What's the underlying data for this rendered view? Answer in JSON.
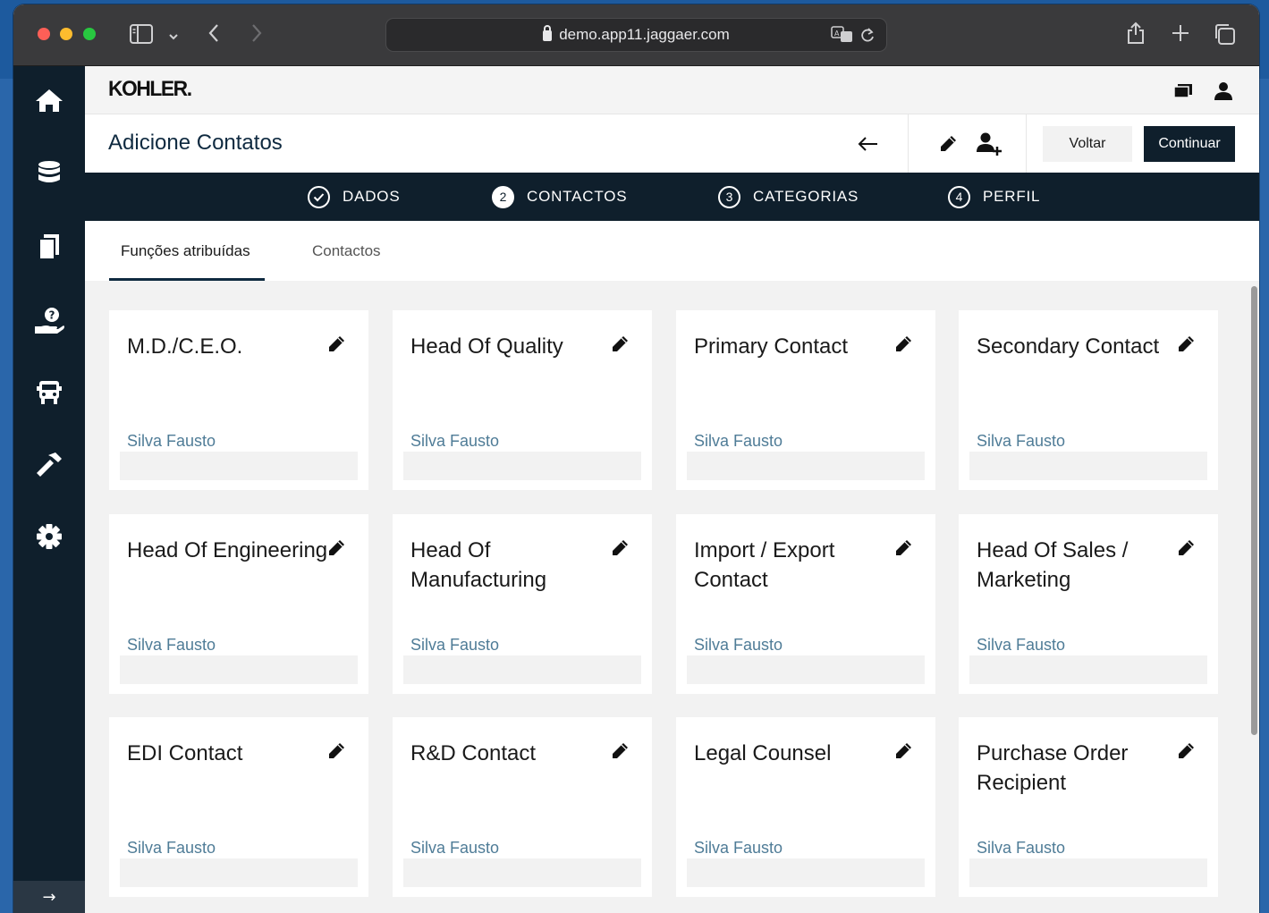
{
  "browser": {
    "url": "demo.app11.jaggaer.com"
  },
  "app": {
    "logo": "KOHLER."
  },
  "header": {
    "title": "Adicione Contatos",
    "voltar_label": "Voltar",
    "continuar_label": "Continuar"
  },
  "steps": [
    {
      "num": "✓",
      "label": "DADOS",
      "state": "done"
    },
    {
      "num": "2",
      "label": "CONTACTOS",
      "state": "active"
    },
    {
      "num": "3",
      "label": "CATEGORIAS",
      "state": "pending"
    },
    {
      "num": "4",
      "label": "PERFIL",
      "state": "pending"
    }
  ],
  "tabs": [
    {
      "label": "Funções atribuídas",
      "active": true
    },
    {
      "label": "Contactos",
      "active": false
    }
  ],
  "cards": [
    {
      "title": "M.D./C.E.O.",
      "person": "Silva Fausto"
    },
    {
      "title": "Head Of Quality",
      "person": "Silva Fausto"
    },
    {
      "title": "Primary Contact",
      "person": "Silva Fausto"
    },
    {
      "title": "Secondary Contact",
      "person": "Silva Fausto"
    },
    {
      "title": "Head Of Engineering",
      "person": "Silva Fausto"
    },
    {
      "title": "Head Of Manufacturing",
      "person": "Silva Fausto"
    },
    {
      "title": "Import / Export Contact",
      "person": "Silva Fausto"
    },
    {
      "title": "Head Of Sales / Marketing",
      "person": "Silva Fausto"
    },
    {
      "title": "EDI Contact",
      "person": "Silva Fausto"
    },
    {
      "title": "R&D Contact",
      "person": "Silva Fausto"
    },
    {
      "title": "Legal Counsel",
      "person": "Silva Fausto"
    },
    {
      "title": "Purchase Order Recipient",
      "person": "Silva Fausto"
    }
  ],
  "sidebar": {
    "items": [
      "home-icon",
      "database-icon",
      "documents-icon",
      "supplier-help-icon",
      "truck-icon",
      "hammer-icon",
      "settings-icon"
    ]
  },
  "colors": {
    "navy": "#0f1f2c",
    "title": "#0f2a40",
    "person_link": "#4f7c97"
  }
}
